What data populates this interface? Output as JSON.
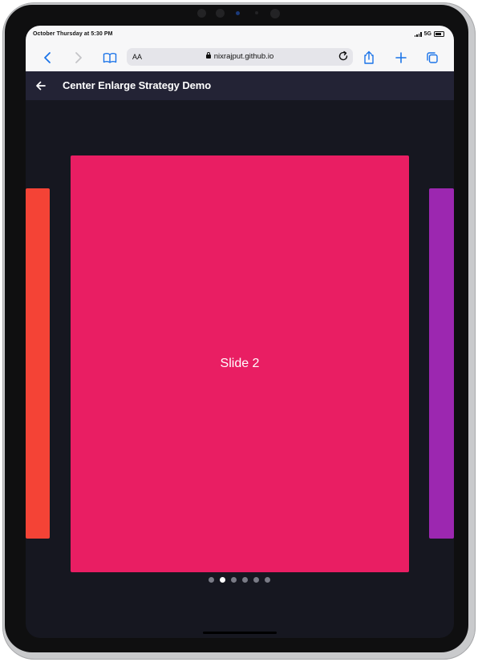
{
  "status_bar": {
    "time_text": "October Thursday at 5:30 PM",
    "network": "5G"
  },
  "browser": {
    "text_size_label": "AA",
    "url": "nixrajput.github.io",
    "accent_color": "#1a73e8"
  },
  "app_bar": {
    "title": "Center Enlarge Strategy Demo",
    "background": "#232335"
  },
  "carousel": {
    "current_label": "Slide 2",
    "slides": [
      {
        "color": "#f44336"
      },
      {
        "color": "#e91e63"
      },
      {
        "color": "#9c27b0"
      }
    ],
    "dot_count": 6,
    "active_index": 1
  }
}
